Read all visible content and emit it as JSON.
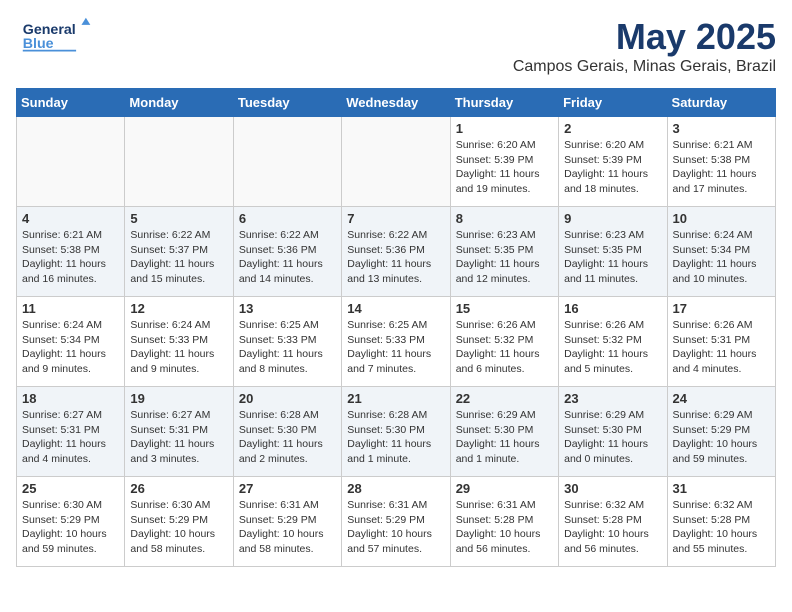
{
  "logo": {
    "line1": "General",
    "line2": "Blue"
  },
  "header": {
    "month": "May 2025",
    "location": "Campos Gerais, Minas Gerais, Brazil"
  },
  "weekdays": [
    "Sunday",
    "Monday",
    "Tuesday",
    "Wednesday",
    "Thursday",
    "Friday",
    "Saturday"
  ],
  "weeks": [
    [
      {
        "day": "",
        "content": ""
      },
      {
        "day": "",
        "content": ""
      },
      {
        "day": "",
        "content": ""
      },
      {
        "day": "",
        "content": ""
      },
      {
        "day": "1",
        "content": "Sunrise: 6:20 AM\nSunset: 5:39 PM\nDaylight: 11 hours\nand 19 minutes."
      },
      {
        "day": "2",
        "content": "Sunrise: 6:20 AM\nSunset: 5:39 PM\nDaylight: 11 hours\nand 18 minutes."
      },
      {
        "day": "3",
        "content": "Sunrise: 6:21 AM\nSunset: 5:38 PM\nDaylight: 11 hours\nand 17 minutes."
      }
    ],
    [
      {
        "day": "4",
        "content": "Sunrise: 6:21 AM\nSunset: 5:38 PM\nDaylight: 11 hours\nand 16 minutes."
      },
      {
        "day": "5",
        "content": "Sunrise: 6:22 AM\nSunset: 5:37 PM\nDaylight: 11 hours\nand 15 minutes."
      },
      {
        "day": "6",
        "content": "Sunrise: 6:22 AM\nSunset: 5:36 PM\nDaylight: 11 hours\nand 14 minutes."
      },
      {
        "day": "7",
        "content": "Sunrise: 6:22 AM\nSunset: 5:36 PM\nDaylight: 11 hours\nand 13 minutes."
      },
      {
        "day": "8",
        "content": "Sunrise: 6:23 AM\nSunset: 5:35 PM\nDaylight: 11 hours\nand 12 minutes."
      },
      {
        "day": "9",
        "content": "Sunrise: 6:23 AM\nSunset: 5:35 PM\nDaylight: 11 hours\nand 11 minutes."
      },
      {
        "day": "10",
        "content": "Sunrise: 6:24 AM\nSunset: 5:34 PM\nDaylight: 11 hours\nand 10 minutes."
      }
    ],
    [
      {
        "day": "11",
        "content": "Sunrise: 6:24 AM\nSunset: 5:34 PM\nDaylight: 11 hours\nand 9 minutes."
      },
      {
        "day": "12",
        "content": "Sunrise: 6:24 AM\nSunset: 5:33 PM\nDaylight: 11 hours\nand 9 minutes."
      },
      {
        "day": "13",
        "content": "Sunrise: 6:25 AM\nSunset: 5:33 PM\nDaylight: 11 hours\nand 8 minutes."
      },
      {
        "day": "14",
        "content": "Sunrise: 6:25 AM\nSunset: 5:33 PM\nDaylight: 11 hours\nand 7 minutes."
      },
      {
        "day": "15",
        "content": "Sunrise: 6:26 AM\nSunset: 5:32 PM\nDaylight: 11 hours\nand 6 minutes."
      },
      {
        "day": "16",
        "content": "Sunrise: 6:26 AM\nSunset: 5:32 PM\nDaylight: 11 hours\nand 5 minutes."
      },
      {
        "day": "17",
        "content": "Sunrise: 6:26 AM\nSunset: 5:31 PM\nDaylight: 11 hours\nand 4 minutes."
      }
    ],
    [
      {
        "day": "18",
        "content": "Sunrise: 6:27 AM\nSunset: 5:31 PM\nDaylight: 11 hours\nand 4 minutes."
      },
      {
        "day": "19",
        "content": "Sunrise: 6:27 AM\nSunset: 5:31 PM\nDaylight: 11 hours\nand 3 minutes."
      },
      {
        "day": "20",
        "content": "Sunrise: 6:28 AM\nSunset: 5:30 PM\nDaylight: 11 hours\nand 2 minutes."
      },
      {
        "day": "21",
        "content": "Sunrise: 6:28 AM\nSunset: 5:30 PM\nDaylight: 11 hours\nand 1 minute."
      },
      {
        "day": "22",
        "content": "Sunrise: 6:29 AM\nSunset: 5:30 PM\nDaylight: 11 hours\nand 1 minute."
      },
      {
        "day": "23",
        "content": "Sunrise: 6:29 AM\nSunset: 5:30 PM\nDaylight: 11 hours\nand 0 minutes."
      },
      {
        "day": "24",
        "content": "Sunrise: 6:29 AM\nSunset: 5:29 PM\nDaylight: 10 hours\nand 59 minutes."
      }
    ],
    [
      {
        "day": "25",
        "content": "Sunrise: 6:30 AM\nSunset: 5:29 PM\nDaylight: 10 hours\nand 59 minutes."
      },
      {
        "day": "26",
        "content": "Sunrise: 6:30 AM\nSunset: 5:29 PM\nDaylight: 10 hours\nand 58 minutes."
      },
      {
        "day": "27",
        "content": "Sunrise: 6:31 AM\nSunset: 5:29 PM\nDaylight: 10 hours\nand 58 minutes."
      },
      {
        "day": "28",
        "content": "Sunrise: 6:31 AM\nSunset: 5:29 PM\nDaylight: 10 hours\nand 57 minutes."
      },
      {
        "day": "29",
        "content": "Sunrise: 6:31 AM\nSunset: 5:28 PM\nDaylight: 10 hours\nand 56 minutes."
      },
      {
        "day": "30",
        "content": "Sunrise: 6:32 AM\nSunset: 5:28 PM\nDaylight: 10 hours\nand 56 minutes."
      },
      {
        "day": "31",
        "content": "Sunrise: 6:32 AM\nSunset: 5:28 PM\nDaylight: 10 hours\nand 55 minutes."
      }
    ]
  ]
}
